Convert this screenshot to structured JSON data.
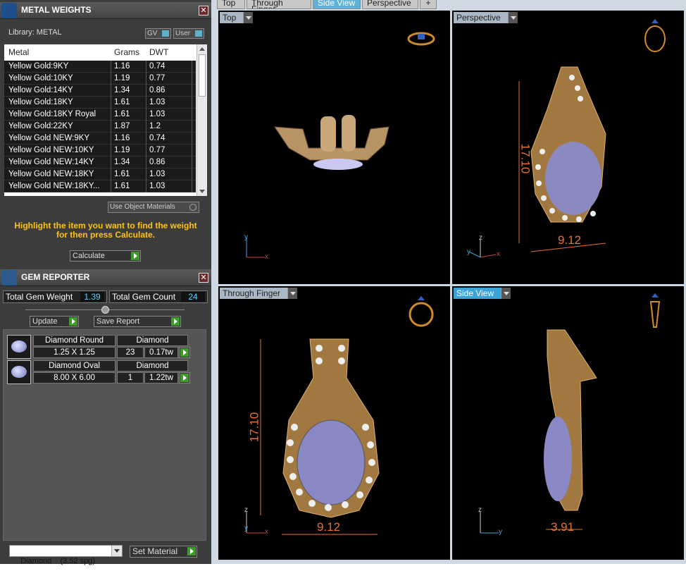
{
  "metal_panel": {
    "title": "METAL WEIGHTS",
    "library_label": "Library: METAL",
    "toggle_gv": "GV",
    "toggle_user": "User",
    "columns": [
      "Metal",
      "Grams",
      "DWT"
    ],
    "rows": [
      {
        "metal": "Yellow Gold:9KY",
        "grams": "1.16",
        "dwt": "0.74"
      },
      {
        "metal": "Yellow Gold:10KY",
        "grams": "1.19",
        "dwt": "0.77"
      },
      {
        "metal": "Yellow Gold:14KY",
        "grams": "1.34",
        "dwt": "0.86"
      },
      {
        "metal": "Yellow Gold:18KY",
        "grams": "1.61",
        "dwt": "1.03"
      },
      {
        "metal": "Yellow Gold:18KY Royal",
        "grams": "1.61",
        "dwt": "1.03"
      },
      {
        "metal": "Yellow Gold:22KY",
        "grams": "1.87",
        "dwt": "1.2"
      },
      {
        "metal": "Yellow Gold NEW:9KY",
        "grams": "1.16",
        "dwt": "0.74"
      },
      {
        "metal": "Yellow Gold NEW:10KY",
        "grams": "1.19",
        "dwt": "0.77"
      },
      {
        "metal": "Yellow Gold NEW:14KY",
        "grams": "1.34",
        "dwt": "0.86"
      },
      {
        "metal": "Yellow Gold NEW:18KY",
        "grams": "1.61",
        "dwt": "1.03"
      },
      {
        "metal": "Yellow Gold NEW:18KY...",
        "grams": "1.61",
        "dwt": "1.03"
      }
    ],
    "use_object_materials": "Use Object Materials",
    "hint_line1": "Highlight the item you want to find the weight",
    "hint_line2": "for then press Calculate.",
    "calculate_button": "Calculate"
  },
  "gem_panel": {
    "title": "GEM REPORTER",
    "total_weight_label": "Total Gem Weight",
    "total_weight_value": "1.39",
    "total_count_label": "Total Gem Count",
    "total_count_value": "24",
    "update_button": "Update",
    "save_report_button": "Save Report",
    "gems": [
      {
        "shape": "Diamond Round",
        "material": "Diamond",
        "size": "1.25 X 1.25",
        "count": "23",
        "weight": "0.17tw"
      },
      {
        "shape": "Diamond Oval",
        "material": "Diamond",
        "size": "8.00 X 6.00",
        "count": "1",
        "weight": "1.22tw"
      }
    ],
    "material_select": "Diamond    (3.52 spg)",
    "set_material_button": "Set Material"
  },
  "tabs": [
    "Top",
    "Through Finger",
    "Side View",
    "Perspective",
    "+"
  ],
  "active_tab": "Side View",
  "viewports": {
    "top": {
      "label": "Top",
      "axis_a": "y",
      "axis_b": "x"
    },
    "perspective": {
      "label": "Perspective",
      "axis_a": "z",
      "axis_b": "x",
      "axis_c": "y",
      "dim_height": "17.10",
      "dim_width": "9.12"
    },
    "through_finger": {
      "label": "Through Finger",
      "axis_a": "z",
      "axis_b": "x",
      "axis_c": "y",
      "dim_height": "17.10",
      "dim_width": "9.12"
    },
    "side_view": {
      "label": "Side View",
      "axis_a": "z",
      "axis_b": "y",
      "dim_width": "3.91"
    }
  },
  "colors": {
    "accent": "#3aa3d8",
    "dimension": "#e8722b",
    "hint": "#ffc20e",
    "gold": "#c79b5c"
  }
}
